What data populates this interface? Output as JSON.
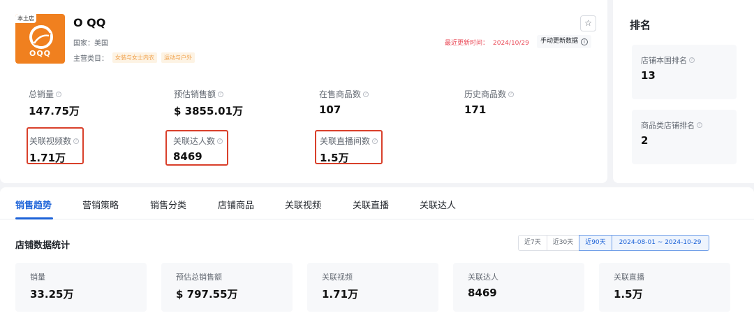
{
  "shop": {
    "logo_tag": "本土店",
    "logo_text": "OQQ",
    "name": "O QQ",
    "country_label": "国家：",
    "country": "美国",
    "category_label": "主营类目：",
    "category_tags": [
      "女装与女士内衣",
      "运动与户外"
    ],
    "fav_icon": "star-icon",
    "update_label": "最近更新时间：",
    "update_time": "2024/10/29",
    "update_button": "手动更新数据",
    "accent": "#f0801f"
  },
  "stats": [
    {
      "label": "总销量",
      "value": "147.75万"
    },
    {
      "label": "预估销售额",
      "value": "$ 3855.01万"
    },
    {
      "label": "在售商品数",
      "value": "107"
    },
    {
      "label": "历史商品数",
      "value": "171"
    },
    {
      "label": "关联视频数",
      "value": "1.71万"
    },
    {
      "label": "关联达人数",
      "value": "8469"
    },
    {
      "label": "关联直播间数",
      "value": "1.5万"
    }
  ],
  "ranking": {
    "title": "排名",
    "items": [
      {
        "label": "店铺本国排名",
        "value": "13"
      },
      {
        "label": "商品类店铺排名",
        "value": "2"
      }
    ]
  },
  "tabs": [
    "销售趋势",
    "营销策略",
    "销售分类",
    "店铺商品",
    "关联视频",
    "关联直播",
    "关联达人"
  ],
  "active_tab": "销售趋势",
  "trend": {
    "title": "店铺数据统计",
    "ranges": [
      "近7天",
      "近30天",
      "近90天"
    ],
    "active_range": "近90天",
    "date_range": "2024-08-01 ~ 2024-10-29",
    "metrics": [
      {
        "label": "销量",
        "value": "33.25万"
      },
      {
        "label": "预估总销售额",
        "value": "$ 797.55万"
      },
      {
        "label": "关联视频",
        "value": "1.71万"
      },
      {
        "label": "关联达人",
        "value": "8469"
      },
      {
        "label": "关联直播",
        "value": "1.5万"
      }
    ]
  },
  "highlight_color": "#d9402b",
  "link_color": "#1d63d8"
}
